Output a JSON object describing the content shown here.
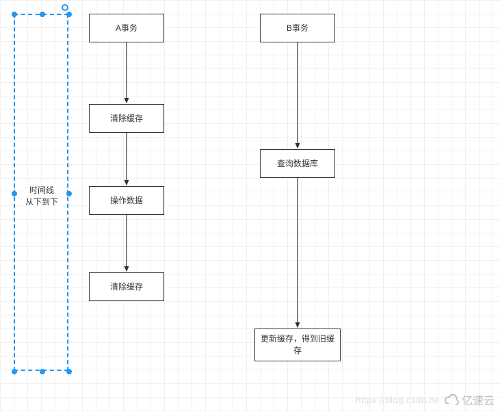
{
  "timeline": {
    "label": "时间线\n从下到下"
  },
  "columnA": {
    "title": "A事务",
    "steps": [
      "清除缓存",
      "操作数据",
      "清除缓存"
    ]
  },
  "columnB": {
    "title": "B事务",
    "steps": [
      "查询数据库",
      "更新缓存，得到旧缓存"
    ]
  },
  "watermark": {
    "url": "https://blog.csdn.ne",
    "brand": "亿速云"
  },
  "chart_data": {
    "type": "diagram",
    "title": "",
    "layout": "flowchart",
    "nodes": [
      {
        "id": "timeline",
        "label": "时间线 从下到下",
        "shape": "dashed-rect",
        "selected": true,
        "column": "axis"
      },
      {
        "id": "a0",
        "label": "A事务",
        "shape": "rect",
        "column": "A",
        "row": 0
      },
      {
        "id": "a1",
        "label": "清除缓存",
        "shape": "rect",
        "column": "A",
        "row": 1
      },
      {
        "id": "a2",
        "label": "操作数据",
        "shape": "rect",
        "column": "A",
        "row": 2
      },
      {
        "id": "a3",
        "label": "清除缓存",
        "shape": "rect",
        "column": "A",
        "row": 3
      },
      {
        "id": "b0",
        "label": "B事务",
        "shape": "rect",
        "column": "B",
        "row": 0
      },
      {
        "id": "b1",
        "label": "查询数据库",
        "shape": "rect",
        "column": "B",
        "row": 1
      },
      {
        "id": "b2",
        "label": "更新缓存，得到旧缓存",
        "shape": "rect",
        "column": "B",
        "row": 2
      }
    ],
    "edges": [
      {
        "from": "a0",
        "to": "a1"
      },
      {
        "from": "a1",
        "to": "a2"
      },
      {
        "from": "a2",
        "to": "a3"
      },
      {
        "from": "b0",
        "to": "b1"
      },
      {
        "from": "b1",
        "to": "b2"
      }
    ]
  }
}
